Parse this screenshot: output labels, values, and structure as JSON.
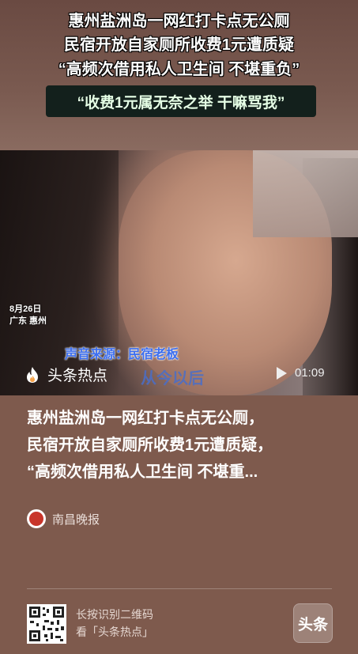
{
  "video": {
    "headline_lines": [
      "惠州盐洲岛一网红打卡点无公厕",
      "民宿开放自家厕所收费1元遭质疑",
      "“高频次借用私人卫生间 不堪重负”"
    ],
    "quote": "“收费1元属无奈之举 干嘛骂我”",
    "date": "8月26日",
    "location": "广东 惠州",
    "voice_source": "声音来源：民宿老板",
    "subtitle": "从今以后",
    "brand": "头条热点",
    "duration": "01:09"
  },
  "article": {
    "desc_lines": [
      "惠州盐洲岛一网红打卡点无公厕，",
      "民宿开放自家厕所收费1元遭质疑，",
      "“高频次借用私人卫生间 不堪重..."
    ],
    "source_name": "南昌晚报"
  },
  "footer": {
    "qr_line1": "长按识别二维码",
    "qr_line2": "看「头条热点」",
    "app_logo_text": "头条"
  },
  "colors": {
    "background": "#7e5a4d",
    "voice_source": "#3d6ff0",
    "quote_box": "#13201c"
  }
}
